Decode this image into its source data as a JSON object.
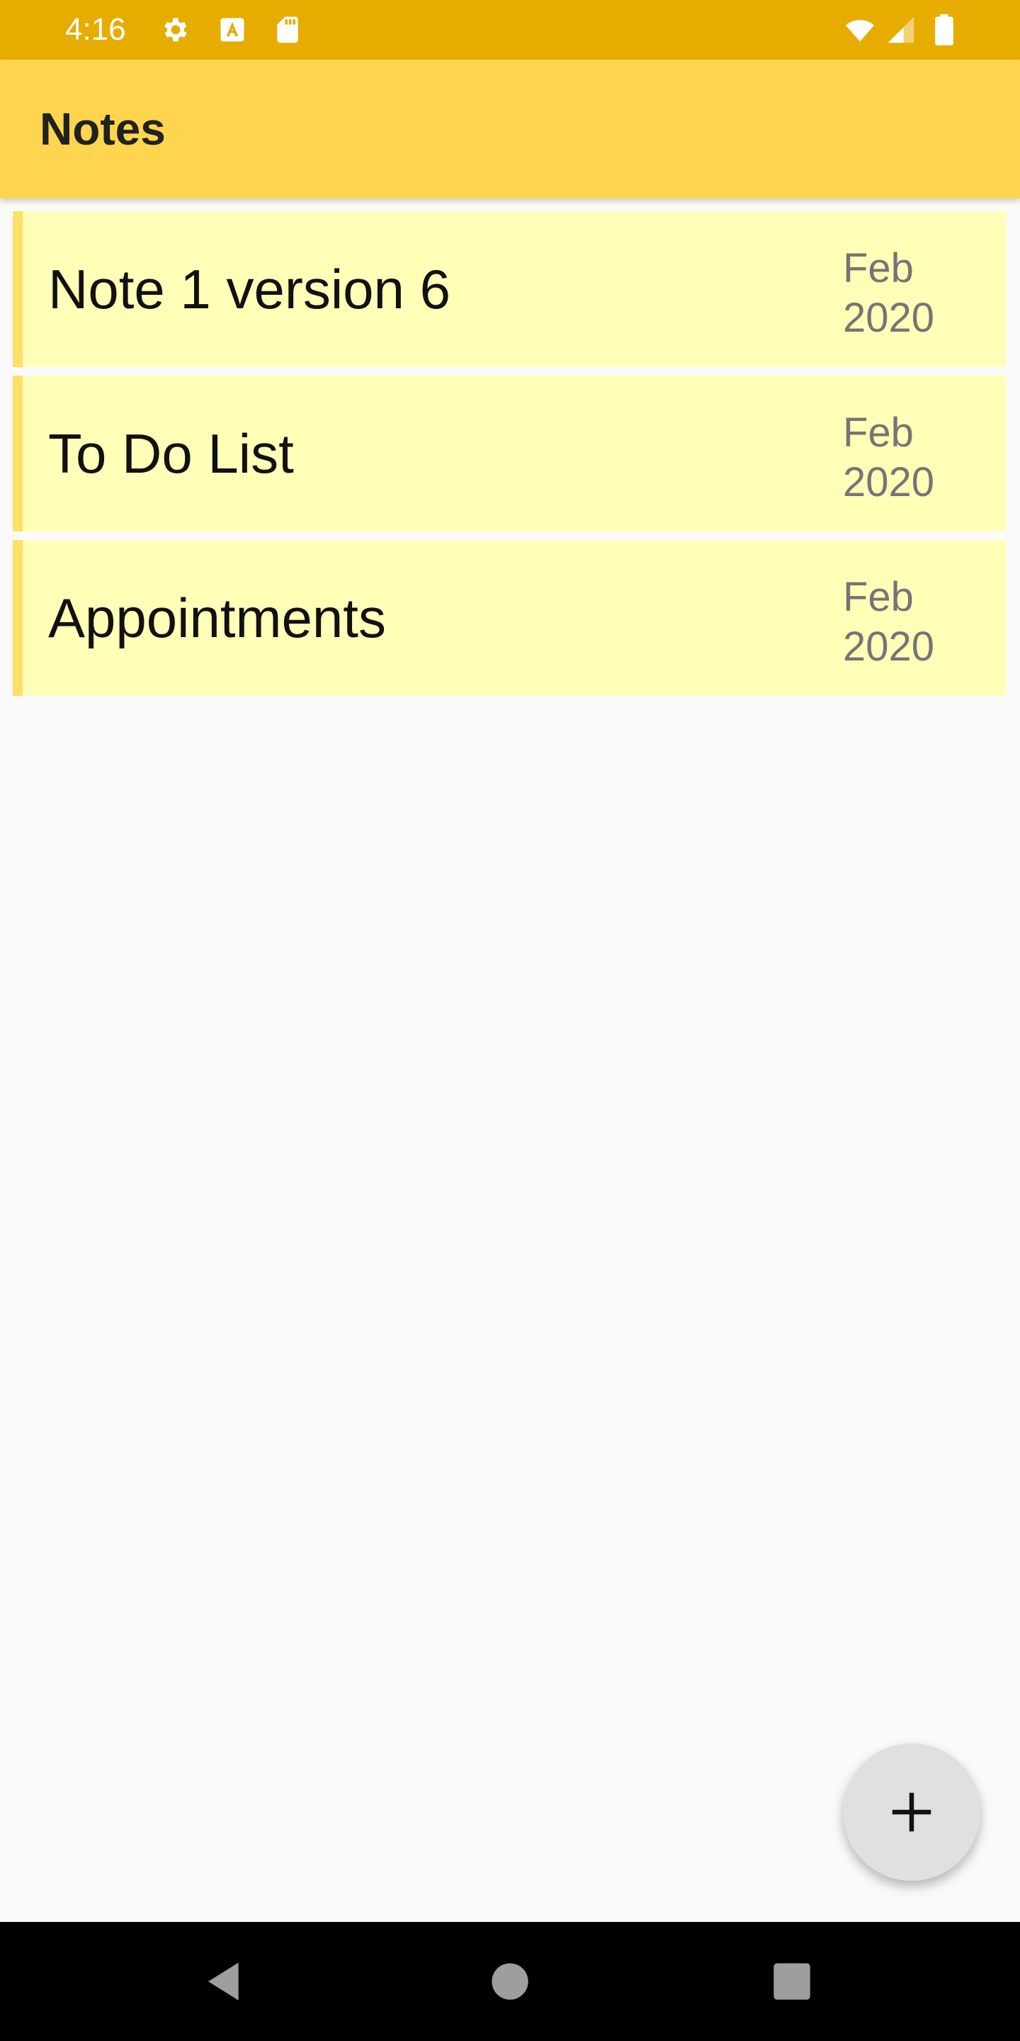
{
  "status_bar": {
    "time": "4:16",
    "icons_left": [
      "gear-icon",
      "font-a-icon",
      "sd-card-icon"
    ],
    "icons_right": [
      "wifi-icon",
      "cell-signal-icon",
      "battery-icon"
    ]
  },
  "app_bar": {
    "title": "Notes"
  },
  "notes": [
    {
      "title": "Note 1 version 6",
      "date_month": "Feb",
      "date_year": "2020"
    },
    {
      "title": "To Do List",
      "date_month": "Feb",
      "date_year": "2020"
    },
    {
      "title": "Appointments",
      "date_month": "Feb",
      "date_year": "2020"
    }
  ],
  "fab": {
    "icon": "plus-icon"
  },
  "nav_bar": {
    "buttons": [
      "back-icon",
      "home-icon",
      "recents-icon"
    ]
  },
  "colors": {
    "status_bar": "#e6ac00",
    "app_bar": "#ffd54f",
    "note_background": "#ffffb8",
    "note_accent": "#ffe066",
    "fab": "#e0e0e0"
  }
}
